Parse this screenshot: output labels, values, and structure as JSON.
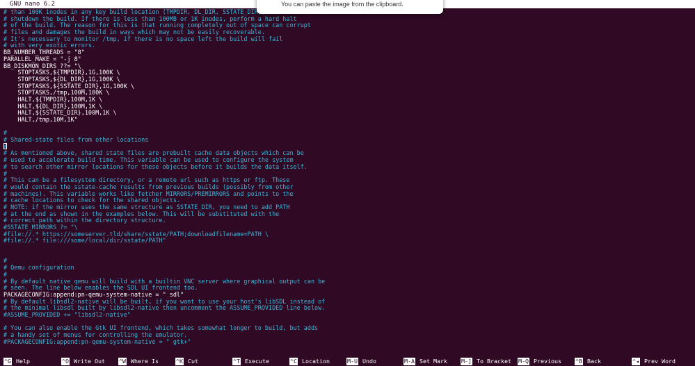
{
  "app": {
    "title": "GNU nano 6.2"
  },
  "toast": {
    "message": "You can paste the image from the clipboard."
  },
  "lines": [
    {
      "text": "# than 100K inodes in any key build location (TMPDIR, DL_DIR, SSTATE_DIR), the build",
      "type": "comment"
    },
    {
      "text": "# shutdown the build. If there is less than 100MB or 1K inodes, perform a hard halt",
      "type": "comment"
    },
    {
      "text": "# of the build. The reason for this is that running completely out of space can corrupt",
      "type": "comment"
    },
    {
      "text": "# files and damages the build in ways which may not be easily recoverable.",
      "type": "comment"
    },
    {
      "text": "# It's necessary to monitor /tmp, if there is no space left the build will fail",
      "type": "comment"
    },
    {
      "text": "# with very exotic errors.",
      "type": "comment"
    },
    {
      "text": "BB_NUMBER_THREADS = \"8\"",
      "type": "code"
    },
    {
      "text": "PARALLEL_MAKE = \"-j 8\"",
      "type": "code"
    },
    {
      "text": "BB_DISKMON_DIRS ??= \"\\",
      "type": "code"
    },
    {
      "text": "    STOPTASKS,${TMPDIR},1G,100K \\",
      "type": "code"
    },
    {
      "text": "    STOPTASKS,${DL_DIR},1G,100K \\",
      "type": "code"
    },
    {
      "text": "    STOPTASKS,${SSTATE_DIR},1G,100K \\",
      "type": "code"
    },
    {
      "text": "    STOPTASKS,/tmp,100M,100K \\",
      "type": "code"
    },
    {
      "text": "    HALT,${TMPDIR},100M,1K \\",
      "type": "code"
    },
    {
      "text": "    HALT,${DL_DIR},100M,1K \\",
      "type": "code"
    },
    {
      "text": "    HALT,${SSTATE_DIR},100M,1K \\",
      "type": "code"
    },
    {
      "text": "    HALT,/tmp,10M,1K\"",
      "type": "code"
    },
    {
      "text": "",
      "type": "code"
    },
    {
      "text": "#",
      "type": "comment"
    },
    {
      "text": "# Shared-state files from other locations",
      "type": "comment"
    },
    {
      "text": "#",
      "type": "comment"
    },
    {
      "text": "# As mentioned above, shared state files are prebuilt cache data objects which can be",
      "type": "comment"
    },
    {
      "text": "# used to accelerate build time. This variable can be used to configure the system",
      "type": "comment"
    },
    {
      "text": "# to search other mirror locations for these objects before it builds the data itself.",
      "type": "comment"
    },
    {
      "text": "#",
      "type": "comment"
    },
    {
      "text": "# This can be a filesystem directory, or a remote url such as https or ftp. These",
      "type": "comment"
    },
    {
      "text": "# would contain the sstate-cache results from previous builds (possibly from other",
      "type": "comment"
    },
    {
      "text": "# machines). This variable works like fetcher MIRRORS/PREMIRRORS and points to the",
      "type": "comment"
    },
    {
      "text": "# cache locations to check for the shared objects.",
      "type": "comment"
    },
    {
      "text": "# NOTE: if the mirror uses the same structure as SSTATE_DIR, you need to add PATH",
      "type": "comment"
    },
    {
      "text": "# at the end as shown in the examples below. This will be substituted with the",
      "type": "comment"
    },
    {
      "text": "# correct path within the directory structure.",
      "type": "comment"
    },
    {
      "text": "#SSTATE_MIRRORS ?= \"\\",
      "type": "comment"
    },
    {
      "text": "#file://.* https://someserver.tld/share/sstate/PATH;downloadfilename=PATH \\",
      "type": "comment"
    },
    {
      "text": "#file://.* file:///some/local/dir/sstate/PATH\"",
      "type": "comment"
    },
    {
      "text": "",
      "type": "code"
    },
    {
      "text": "",
      "type": "code"
    },
    {
      "text": "#",
      "type": "comment"
    },
    {
      "text": "# Qemu configuration",
      "type": "comment"
    },
    {
      "text": "#",
      "type": "comment"
    },
    {
      "text": "# By default native qemu will build with a builtin VNC server where graphical output can be",
      "type": "comment"
    },
    {
      "text": "# seen. The line below enables the SDL UI frontend too.",
      "type": "comment"
    },
    {
      "text": "PACKAGECONFIG:append:pn-qemu-system-native = \" sdl\"",
      "type": "code"
    },
    {
      "text": "# By default libsdl2-native will be built, if you want to use your host's libSDL instead of",
      "type": "comment"
    },
    {
      "text": "# the minimal libsdl built by libsdl2-native then uncomment the ASSUME_PROVIDED line below.",
      "type": "comment"
    },
    {
      "text": "#ASSUME_PROVIDED += \"libsdl2-native\"",
      "type": "comment"
    },
    {
      "text": "",
      "type": "code"
    },
    {
      "text": "# You can also enable the Gtk UI frontend, which takes somewhat longer to build, but adds",
      "type": "comment"
    },
    {
      "text": "# a handy set of menus for controlling the emulator.",
      "type": "comment"
    },
    {
      "text": "#PACKAGECONFIG:append:pn-qemu-system-native = \" gtk+\"",
      "type": "comment"
    }
  ],
  "shortcuts": [
    {
      "key": "^G",
      "label": "Help"
    },
    {
      "key": "^O",
      "label": "Write Out"
    },
    {
      "key": "^W",
      "label": "Where Is"
    },
    {
      "key": "^K",
      "label": "Cut"
    },
    {
      "key": "^T",
      "label": "Execute"
    },
    {
      "key": "^C",
      "label": "Location"
    },
    {
      "key": "M-U",
      "label": "Undo"
    },
    {
      "key": "M-A",
      "label": "Set Mark"
    },
    {
      "key": "M-]",
      "label": "To Bracket"
    },
    {
      "key": "M-Q",
      "label": "Previous"
    },
    {
      "key": "^B",
      "label": "Back"
    },
    {
      "key": "^◂",
      "label": "Prev Word"
    }
  ],
  "colors": {
    "background": "#300a24",
    "comment": "#3db5d8",
    "code": "#ffffff"
  }
}
